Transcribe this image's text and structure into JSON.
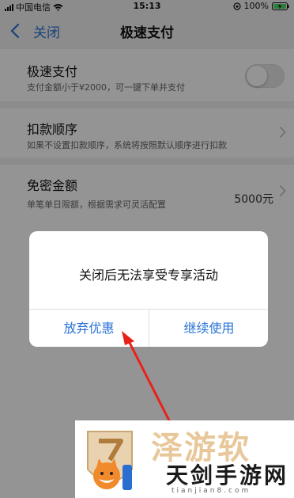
{
  "status_bar": {
    "carrier": "中国电信",
    "time": "15:13",
    "battery": "100%",
    "icons": [
      "signal-icon",
      "wifi-icon",
      "orientation-lock-icon",
      "battery-charging-icon"
    ]
  },
  "nav": {
    "back_label": "关闭",
    "title": "极速支付"
  },
  "settings": [
    {
      "title": "极速支付",
      "desc": "支付金额小于¥2000，可一键下单并支付",
      "control": "toggle",
      "enabled": false
    },
    {
      "title": "扣款顺序",
      "desc": "如果不设置扣款顺序，系统将按照默认顺序进行扣款",
      "control": "chevron"
    },
    {
      "title": "免密金额",
      "desc": "单笔单日限额，根据需求可灵活配置",
      "value": "5000元",
      "control": "chevron"
    }
  ],
  "dialog": {
    "message": "关闭后无法享受专享活动",
    "left_button": "放弃优惠",
    "right_button": "继续使用"
  },
  "annotation": {
    "arrow_color": "#e8221b"
  },
  "watermark": {
    "faded_text": "泽游软",
    "name": "天剑手游网",
    "domain": "tianjian8.com"
  },
  "colors": {
    "accent": "#2a73d6",
    "background": "#f2f2f2",
    "overlay": "rgba(0,0,0,0.42)"
  }
}
